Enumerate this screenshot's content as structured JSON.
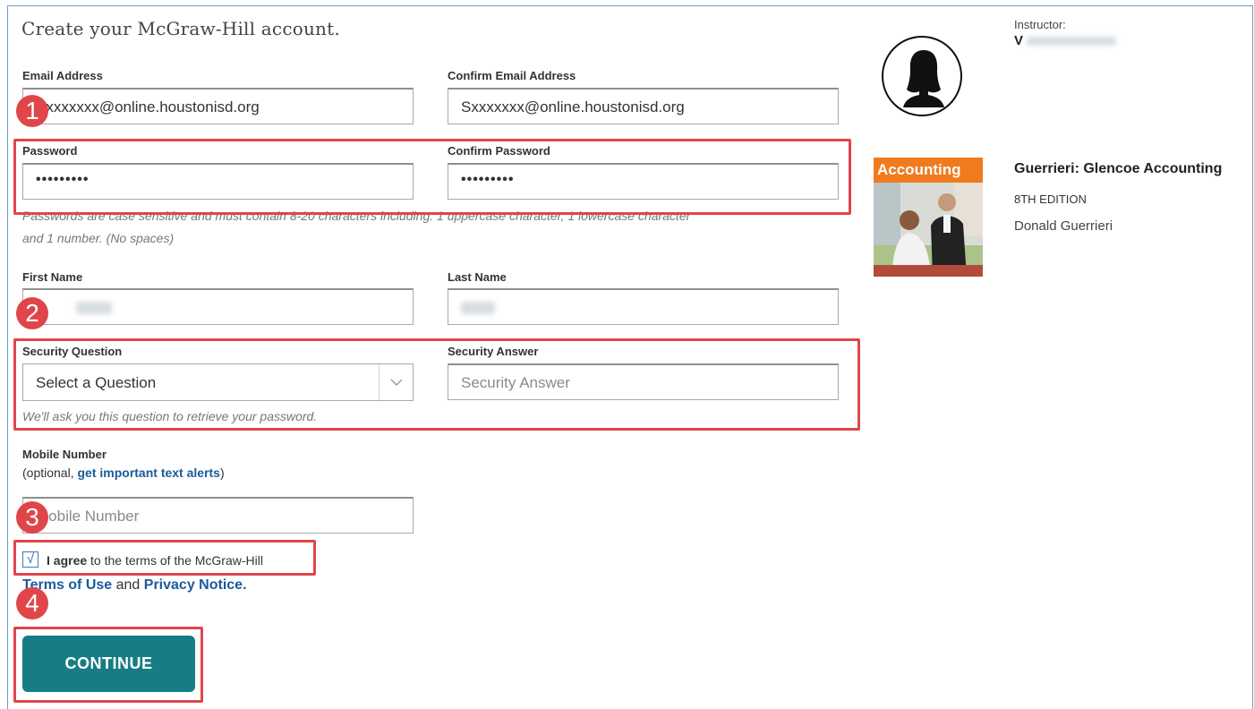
{
  "page": {
    "title": "Create your McGraw-Hill account."
  },
  "form": {
    "email": {
      "label": "Email Address",
      "value": "Sxxxxxxx@online.houstonisd.org"
    },
    "confirm_email": {
      "label": "Confirm Email Address",
      "value": "Sxxxxxxx@online.houstonisd.org"
    },
    "password": {
      "label": "Password",
      "value": "•••••••••"
    },
    "confirm_password": {
      "label": "Confirm Password",
      "value": "•••••••••"
    },
    "password_hint_line1": "Passwords are case sensitive and must contain 8-20 characters including: 1 uppercase character, 1 lowercase character",
    "password_hint_line2": "and 1 number. (No spaces)",
    "first_name": {
      "label": "First Name"
    },
    "last_name": {
      "label": "Last Name"
    },
    "security_question": {
      "label": "Security Question",
      "selected": "Select a Question"
    },
    "security_answer": {
      "label": "Security Answer",
      "placeholder": "Security Answer"
    },
    "security_hint": "We'll ask you this question to retrieve your password.",
    "mobile": {
      "label": "Mobile Number",
      "optional_prefix": "(optional, ",
      "optional_link": "get important text alerts",
      "optional_suffix": ")",
      "placeholder": "Mobile Number"
    },
    "agree": {
      "checkmark": "√",
      "bold": "I agree",
      "text": " to the terms of the McGraw-Hill",
      "terms_link": "Terms of Use",
      "and": " and ",
      "privacy_link": "Privacy Notice."
    },
    "continue_label": "CONTINUE"
  },
  "annotations": {
    "step1": "1",
    "step2": "2",
    "step3": "3",
    "step4": "4",
    "color": "#e0454a"
  },
  "sidebar": {
    "instructor_label": "Instructor:",
    "instructor_initial": "V",
    "book": {
      "cover_title": "Accounting",
      "name": "Guerrieri: Glencoe Accounting",
      "edition": "8TH EDITION",
      "author": "Donald Guerrieri"
    }
  },
  "colors": {
    "accent_button": "#177c85",
    "link": "#1a5b9a",
    "book_band": "#f07b1f"
  }
}
